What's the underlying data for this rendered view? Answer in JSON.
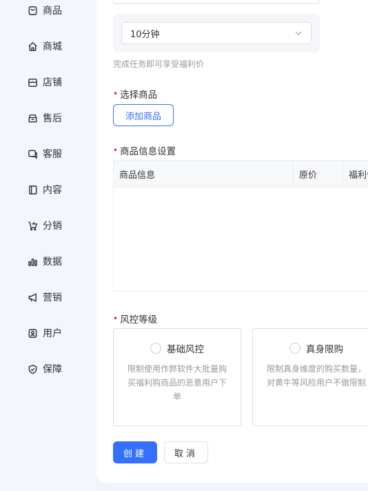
{
  "sidebar": {
    "items": [
      {
        "label": "商品",
        "icon": "bag-icon"
      },
      {
        "label": "商城",
        "icon": "home-icon"
      },
      {
        "label": "店铺",
        "icon": "store-icon"
      },
      {
        "label": "售后",
        "icon": "service-box-icon"
      },
      {
        "label": "客服",
        "icon": "chat-icon"
      },
      {
        "label": "内容",
        "icon": "book-icon"
      },
      {
        "label": "分销",
        "icon": "cart-icon"
      },
      {
        "label": "数据",
        "icon": "bar-chart-icon"
      },
      {
        "label": "营销",
        "icon": "megaphone-icon"
      },
      {
        "label": "用户",
        "icon": "user-icon"
      },
      {
        "label": "保障",
        "icon": "shield-icon"
      }
    ]
  },
  "form": {
    "time_select": {
      "value": "10分钟"
    },
    "time_hint": "完成任务即可享受福利价",
    "select_goods": {
      "label": "选择商品",
      "button": "添加商品"
    },
    "goods_info": {
      "label": "商品信息设置",
      "columns": [
        "商品信息",
        "原价",
        "福利价"
      ]
    },
    "risk": {
      "label": "风控等级",
      "options": [
        {
          "title": "基础风控",
          "desc": "限制使用作弊软件大批量购买福利购商品的恶意用户下单",
          "selected": false
        },
        {
          "title": "真身限购",
          "desc": "限制真身维度的购买数量，对黄牛等风险用户不做限制",
          "selected": false
        }
      ]
    },
    "submit_label": "创建",
    "cancel_label": "取消"
  },
  "colors": {
    "accent": "#3370ff",
    "required": "#f5222d"
  }
}
